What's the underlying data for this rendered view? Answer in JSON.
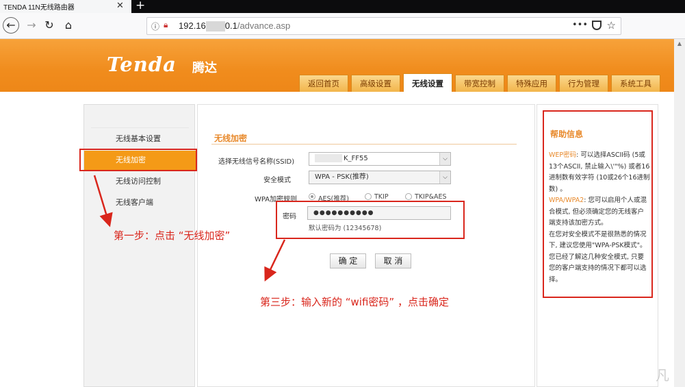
{
  "browser": {
    "tab_title": "TENDA 11N无线路由器",
    "tab_close": "✕",
    "new_tab": "+",
    "url_host_prefix": "192.16",
    "url_host_suffix": "0.1",
    "url_path": "/advance.asp",
    "menu_dots": "•••",
    "back_icon": "←",
    "forward_icon": "→",
    "reload_icon": "↻",
    "home_icon": "⌂",
    "info_icon": "ⓘ",
    "star_icon": "☆"
  },
  "header": {
    "logo": "Tenda",
    "logo_cn": "腾达",
    "nav": [
      {
        "label": "返回首页",
        "active": false
      },
      {
        "label": "高级设置",
        "active": false
      },
      {
        "label": "无线设置",
        "active": true
      },
      {
        "label": "带宽控制",
        "active": false
      },
      {
        "label": "特殊应用",
        "active": false
      },
      {
        "label": "行为管理",
        "active": false
      },
      {
        "label": "系统工具",
        "active": false
      }
    ]
  },
  "sidebar": {
    "items": [
      {
        "label": "无线基本设置",
        "active": false
      },
      {
        "label": "无线加密",
        "active": true
      },
      {
        "label": "无线访问控制",
        "active": false
      },
      {
        "label": "无线客户端",
        "active": false
      }
    ]
  },
  "form": {
    "section_title": "无线加密",
    "ssid_label": "选择无线信号名称(SSID)",
    "ssid_value": "K_FF55",
    "security_label": "安全模式",
    "security_value": "WPA - PSK(推荐)",
    "wpa_rule_label": "WPA加密规则",
    "wpa_options": [
      {
        "label": "AES(推荐)",
        "checked": true
      },
      {
        "label": "TKIP",
        "checked": false
      },
      {
        "label": "TKIP&AES",
        "checked": false
      }
    ],
    "password_label": "密码",
    "password_value": "●●●●●●●●●●",
    "password_hint": "默认密码为 (12345678)",
    "ok_button": "确 定",
    "cancel_button": "取 消",
    "select_arrow": "⌵"
  },
  "help": {
    "title": "帮助信息",
    "wep_key": "WEP密码",
    "wep_text": ": 可以选择ASCII码 (5或13个ASCII, 禁止输入\\'\"%) 或者16进制数有效字符 (10或26个16进制数) 。",
    "wpa_key": "WPA/WPA2",
    "wpa_text": ": 您可以启用个人或混合模式, 但必须确定您的无线客户端支持该加密方式。",
    "note_text": "在您对安全模式不是很熟悉的情况下, 建议您使用\"WPA-PSK模式\"。您已经了解这几种安全模式, 只要您的客户端支持的情况下都可以选择。"
  },
  "annotations": {
    "step1": "第一步：点击 “无线加密”",
    "step3": "第三步：输入新的 “wifi密码” ，点击确定"
  },
  "watermark": "凡",
  "colors": {
    "brand_orange": "#f08c1d",
    "active_orange": "#f49a17",
    "annotation_red": "#d9261c"
  }
}
